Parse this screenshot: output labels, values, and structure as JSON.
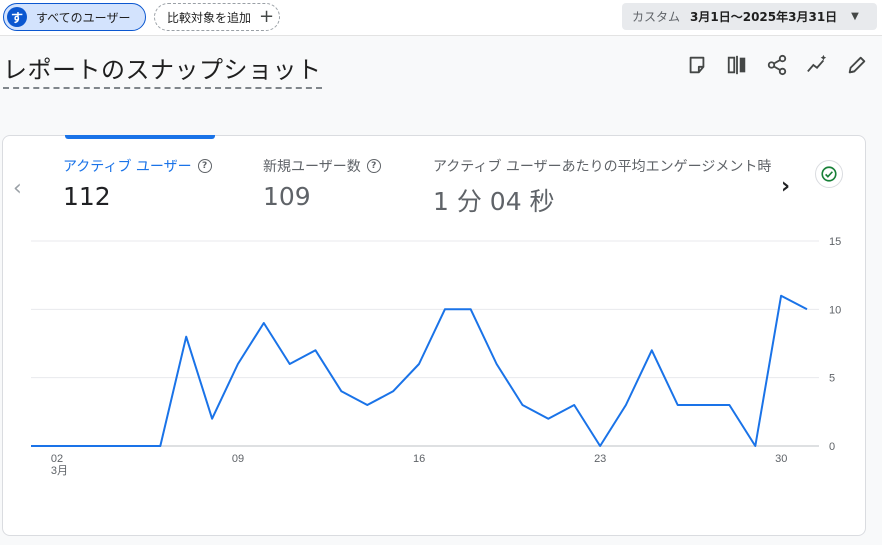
{
  "topbar": {
    "segment_badge": "す",
    "segment_label": "すべてのユーザー",
    "add_compare_label": "比較対象を追加",
    "date_custom_label": "カスタム",
    "date_range": "3月1日～2025年3月31日"
  },
  "page": {
    "title": "レポートのスナップショット"
  },
  "metrics": [
    {
      "label": "アクティブ ユーザー",
      "value": "112",
      "active": true
    },
    {
      "label": "新規ユーザー数",
      "value": "109",
      "active": false
    },
    {
      "label": "アクティブ ユーザーあたりの平均エンゲージメント時",
      "value": "1 分 04 秒",
      "active": false
    }
  ],
  "colors": {
    "accent": "#1a73e8",
    "line": "#1a73e8",
    "check": "#188038"
  },
  "chart_data": {
    "type": "line",
    "x": [
      "2025-03-01",
      "2025-03-02",
      "2025-03-03",
      "2025-03-04",
      "2025-03-05",
      "2025-03-06",
      "2025-03-07",
      "2025-03-08",
      "2025-03-09",
      "2025-03-10",
      "2025-03-11",
      "2025-03-12",
      "2025-03-13",
      "2025-03-14",
      "2025-03-15",
      "2025-03-16",
      "2025-03-17",
      "2025-03-18",
      "2025-03-19",
      "2025-03-20",
      "2025-03-21",
      "2025-03-22",
      "2025-03-23",
      "2025-03-24",
      "2025-03-25",
      "2025-03-26",
      "2025-03-27",
      "2025-03-28",
      "2025-03-29",
      "2025-03-30",
      "2025-03-31"
    ],
    "values": [
      0,
      0,
      0,
      0,
      0,
      0,
      8,
      2,
      6,
      9,
      6,
      7,
      4,
      3,
      4,
      6,
      10,
      10,
      6,
      3,
      2,
      3,
      0,
      3,
      7,
      3,
      3,
      3,
      0,
      11,
      10
    ],
    "x_tick_labels": [
      {
        "index": 1,
        "label": "02",
        "sublabel": "3月"
      },
      {
        "index": 8,
        "label": "09",
        "sublabel": ""
      },
      {
        "index": 15,
        "label": "16",
        "sublabel": ""
      },
      {
        "index": 22,
        "label": "23",
        "sublabel": ""
      },
      {
        "index": 29,
        "label": "30",
        "sublabel": ""
      }
    ],
    "y_ticks": [
      0,
      5,
      10,
      15
    ],
    "ylim": [
      0,
      15
    ],
    "grid": true
  }
}
